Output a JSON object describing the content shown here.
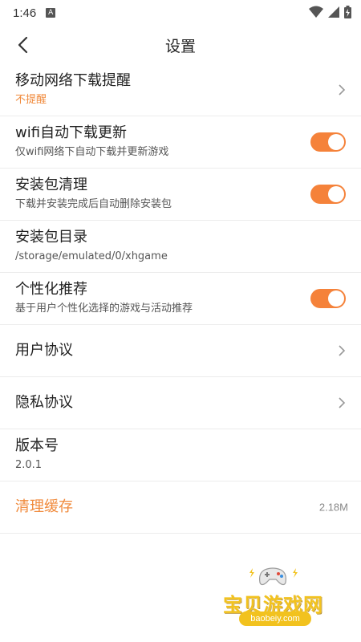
{
  "status_bar": {
    "time": "1:46",
    "notif_letter": "A"
  },
  "header": {
    "title": "设置"
  },
  "settings": {
    "mobile_download_alert": {
      "title": "移动网络下载提醒",
      "value": "不提醒"
    },
    "wifi_auto_update": {
      "title": "wifi自动下载更新",
      "desc": "仅wifi网络下自动下载并更新游戏",
      "enabled": true
    },
    "package_cleanup": {
      "title": "安装包清理",
      "desc": "下载并安装完成后自动删除安装包",
      "enabled": true
    },
    "package_directory": {
      "title": "安装包目录",
      "path": "/storage/emulated/0/xhgame"
    },
    "personalized_recommend": {
      "title": "个性化推荐",
      "desc": "基于用户个性化选择的游戏与活动推荐",
      "enabled": true
    },
    "user_agreement": {
      "title": "用户协议"
    },
    "privacy_agreement": {
      "title": "隐私协议"
    },
    "version": {
      "title": "版本号",
      "value": "2.0.1"
    },
    "clear_cache": {
      "title": "清理缓存",
      "size": "2.18M"
    }
  },
  "watermark": {
    "text": "宝贝游戏网",
    "url": "baobeiy.com"
  },
  "colors": {
    "accent": "#f5823a",
    "accent_text": "#f08a3c",
    "divider": "#ececec"
  }
}
